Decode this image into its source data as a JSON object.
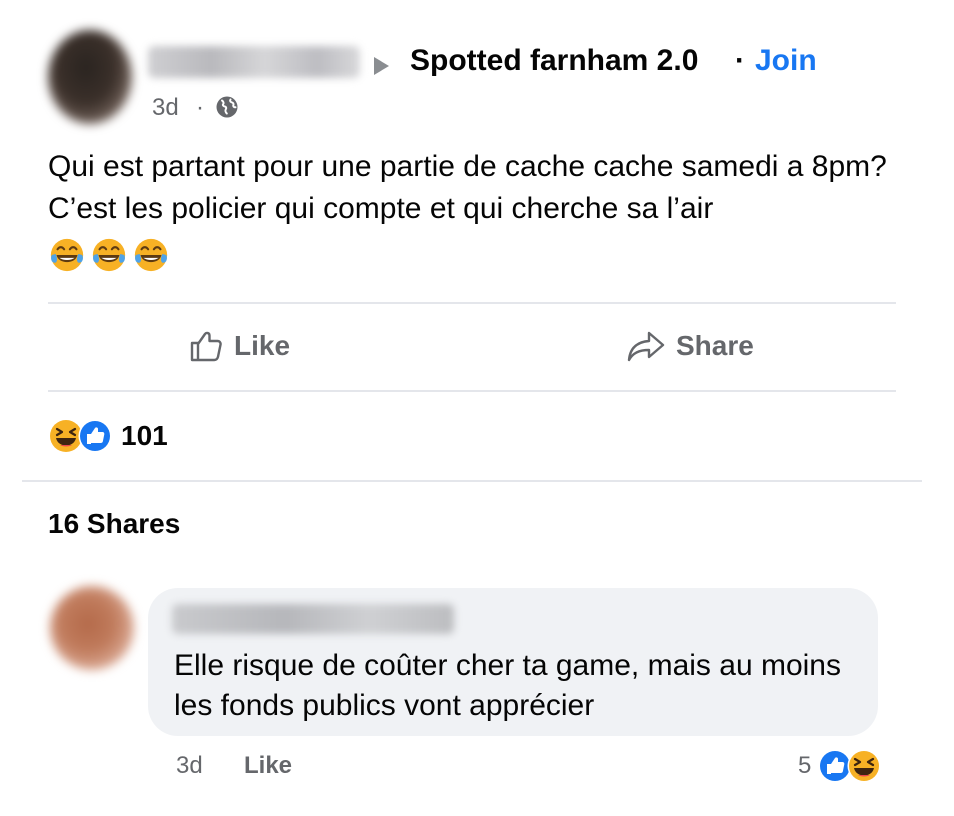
{
  "post": {
    "time": "3d",
    "separator": "·",
    "group_name": "Spotted farnham 2.0",
    "join_label": "Join",
    "text": "Qui est partant pour une partie de cache cache samedi a 8pm? C’est les policier qui compte et qui cherche sa l’air",
    "emoji": [
      "face-with-tears-of-joy-emoji",
      "face-with-tears-of-joy-emoji",
      "face-with-tears-of-joy-emoji"
    ]
  },
  "actions": {
    "like_label": "Like",
    "share_label": "Share"
  },
  "reactions": {
    "icons": [
      "haha-reaction-icon",
      "like-reaction-icon"
    ],
    "count": "101"
  },
  "shares_label": "16 Shares",
  "comment": {
    "text": "Elle risque de coûter cher ta game, mais au moins les fonds publics vont apprécier",
    "time": "3d",
    "like_label": "Like",
    "reaction_count": "5",
    "reaction_icons": [
      "like-reaction-icon",
      "haha-reaction-icon"
    ]
  },
  "colors": {
    "accent": "#1877f2",
    "secondary_text": "#65676b",
    "divider": "#e4e6eb",
    "bubble": "#f0f2f5",
    "haha_yellow": "#f7b125"
  }
}
